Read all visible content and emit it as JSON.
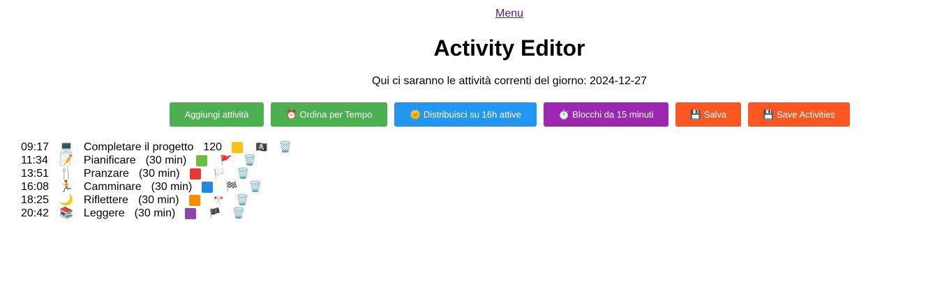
{
  "menu_label": "Menu",
  "title": "Activity Editor",
  "subtitle": "Qui ci saranno le attività correnti del giorno: 2024-12-27",
  "toolbar": {
    "add": "Aggiungi attività",
    "sort": "⏰ Ordina per Tempo",
    "distribute": "🌞 Distribuisci su 16h attive",
    "blocks": "⏱️ Blocchi da 15 minuti",
    "save": "💾 Salva",
    "save_activities": "💾 Save Activities"
  },
  "colors": {
    "green": "#4caf50",
    "blue": "#2196f3",
    "purple": "#9c27b0",
    "orange": "#ff5722",
    "link": "#551a8b"
  },
  "activities": [
    {
      "time": "09:17",
      "icon": "💻",
      "name": "Completare il progetto",
      "duration": "120",
      "color": "#f4c21b",
      "flag": "🏴‍☠️",
      "delete": "🗑️"
    },
    {
      "time": "11:34",
      "icon": "📝",
      "name": "Pianificare",
      "duration": "(30 min)",
      "color": "#6cbc3e",
      "flag": "🚩",
      "delete": "🗑️"
    },
    {
      "time": "13:51",
      "icon": "🍴",
      "name": "Pranzare",
      "duration": "(30 min)",
      "color": "#e53935",
      "flag": "🏳️",
      "delete": "🗑️"
    },
    {
      "time": "16:08",
      "icon": "🏃",
      "name": "Camminare",
      "duration": "(30 min)",
      "color": "#1e88e5",
      "flag": "🏁",
      "delete": "🗑️"
    },
    {
      "time": "18:25",
      "icon": "🌙",
      "name": "Riflettere",
      "duration": "(30 min)",
      "color": "#fb8c00",
      "flag": "🎌",
      "delete": "🗑️"
    },
    {
      "time": "20:42",
      "icon": "📚",
      "name": "Leggere",
      "duration": "(30 min)",
      "color": "#8e44ad",
      "flag": "🏴",
      "delete": "🗑️"
    }
  ]
}
